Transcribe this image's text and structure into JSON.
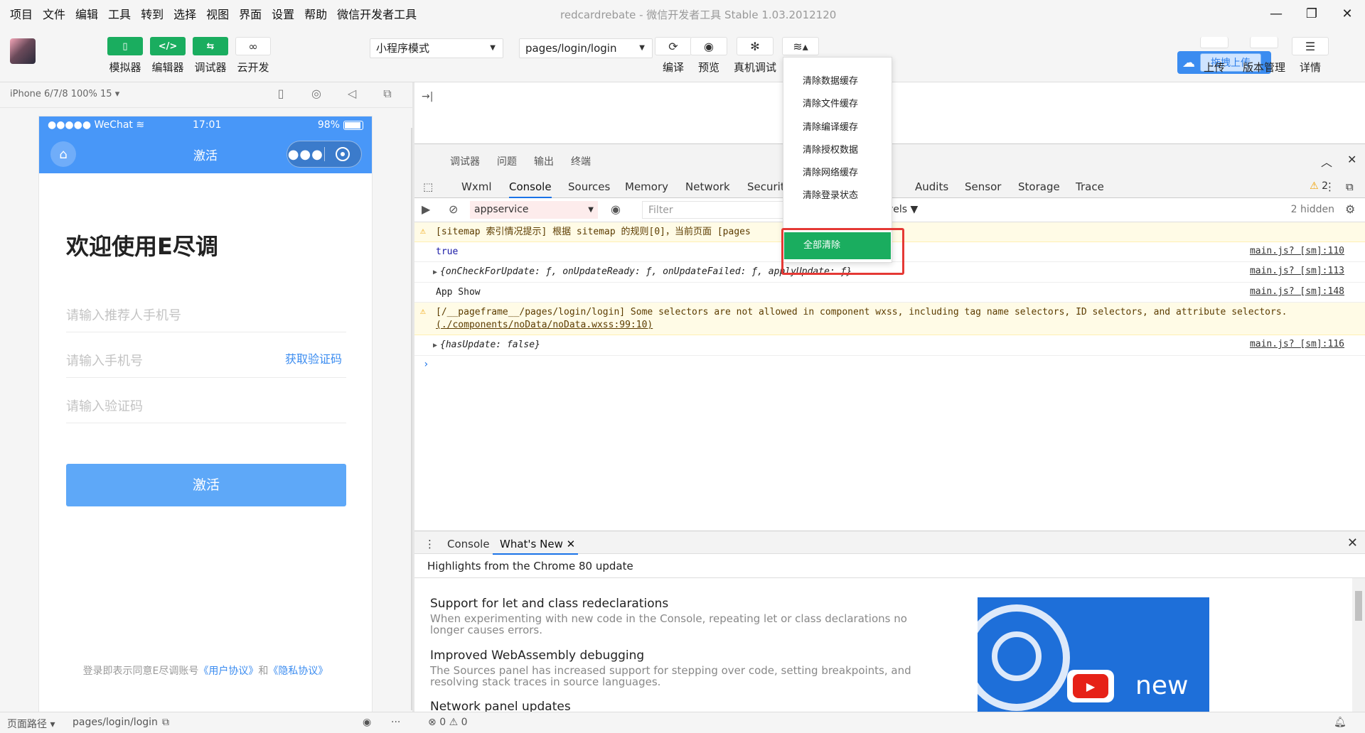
{
  "menubar": {
    "items": [
      "项目",
      "文件",
      "编辑",
      "工具",
      "转到",
      "选择",
      "视图",
      "界面",
      "设置",
      "帮助",
      "微信开发者工具"
    ],
    "window_title": "redcardrebate  -  微信开发者工具 Stable 1.03.2012120"
  },
  "toolbar": {
    "simulator": "模拟器",
    "editor": "编辑器",
    "debugger": "调试器",
    "cloud": "云开发",
    "mode_select": "小程序模式",
    "page_select": "pages/login/login",
    "compile": "编译",
    "preview": "预览",
    "remote_debug": "真机调试",
    "upload": "上传",
    "version": "版本管理",
    "details": "详情",
    "drag_upload": "拖拽上传"
  },
  "simulator": {
    "device": "iPhone 6/7/8 100% 15 ▾",
    "status_left": "●●●●● WeChat ",
    "status_time": "17:01",
    "status_battery": "98%",
    "nav_title": "激活",
    "welcome": "欢迎使用E尽调",
    "ref_phone_placeholder": "请输入推荐人手机号",
    "phone_placeholder": "请输入手机号",
    "get_code": "获取验证码",
    "code_placeholder": "请输入验证码",
    "activate_button": "激活",
    "agreement_prefix": "登录即表示同意E尽调账号",
    "user_agreement": "《用户协议》",
    "and": "和",
    "privacy_agreement": "《隐私协议》"
  },
  "devtools": {
    "top_tabs": [
      "调试器",
      "问题",
      "输出",
      "终端"
    ],
    "tabs": [
      "Wxml",
      "Console",
      "Sources",
      "Memory",
      "Network",
      "Security",
      "Audits",
      "Sensor",
      "Storage",
      "Trace"
    ],
    "warning_count": "2",
    "context": "appservice",
    "filter_placeholder": "Filter",
    "levels": "vels ▼",
    "hidden": "2 hidden",
    "console": [
      {
        "type": "warn",
        "msg": "[sitemap 索引情况提示] 根据 sitemap 的规则[0]，当前页面 [pages",
        "src": ""
      },
      {
        "type": "log",
        "msg": "true",
        "src": "main.js? [sm]:110"
      },
      {
        "type": "obj",
        "msg": "{onCheckForUpdate: ƒ, onUpdateReady: ƒ, onUpdateFailed: ƒ, applyUpdate: ƒ}",
        "src": "main.js? [sm]:113"
      },
      {
        "type": "log",
        "msg": "App Show",
        "src": "main.js? [sm]:148"
      },
      {
        "type": "warn2",
        "msg": "[/__pageframe__/pages/login/login] Some selectors are not allowed in component wxss, including tag name selectors, ID selectors, and attribute selectors.",
        "msg2": "(./components/noData/noData.wxss:99:10)",
        "src": ""
      },
      {
        "type": "obj",
        "msg": "{hasUpdate: false}",
        "src": "main.js? [sm]:116"
      }
    ]
  },
  "dropdown": {
    "items": [
      "清除数据缓存",
      "清除文件缓存",
      "清除编译缓存",
      "清除授权数据",
      "清除网络缓存",
      "清除登录状态"
    ],
    "clear_all": "全部清除"
  },
  "drawer": {
    "tab_console": "Console",
    "tab_whatsnew": "What's New",
    "highlights": "Highlights from the Chrome 80 update",
    "features": [
      {
        "title": "Support for let and class redeclarations",
        "desc": "When experimenting with new code in the Console, repeating let or class declarations no longer causes errors."
      },
      {
        "title": "Improved WebAssembly debugging",
        "desc": "The Sources panel has increased support for stepping over code, setting breakpoints, and resolving stack traces in source languages."
      },
      {
        "title": "Network panel updates",
        "desc": ""
      }
    ],
    "promo_text": "new"
  },
  "statusbar": {
    "page_path_label": "页面路径 ▾",
    "page_path": "pages/login/login",
    "errors": "0",
    "warnings": "0"
  }
}
